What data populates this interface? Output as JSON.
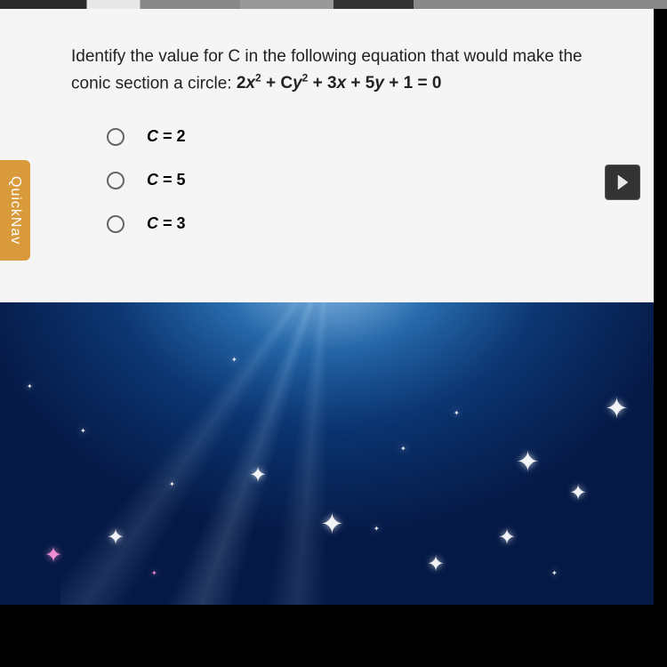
{
  "question": {
    "prompt_line1": "Identify the value for C in the following equation that would make the",
    "prompt_line2": "conic section a circle: ",
    "equation_html": "2x² + Cy² + 3x + 5y + 1 = 0"
  },
  "options": [
    {
      "label": "C = 2"
    },
    {
      "label": "C = 5"
    },
    {
      "label": "C = 3"
    }
  ],
  "sidebar": {
    "quicknav_label": "QuickNav"
  },
  "nav": {
    "next_icon": "next-arrow-icon"
  }
}
